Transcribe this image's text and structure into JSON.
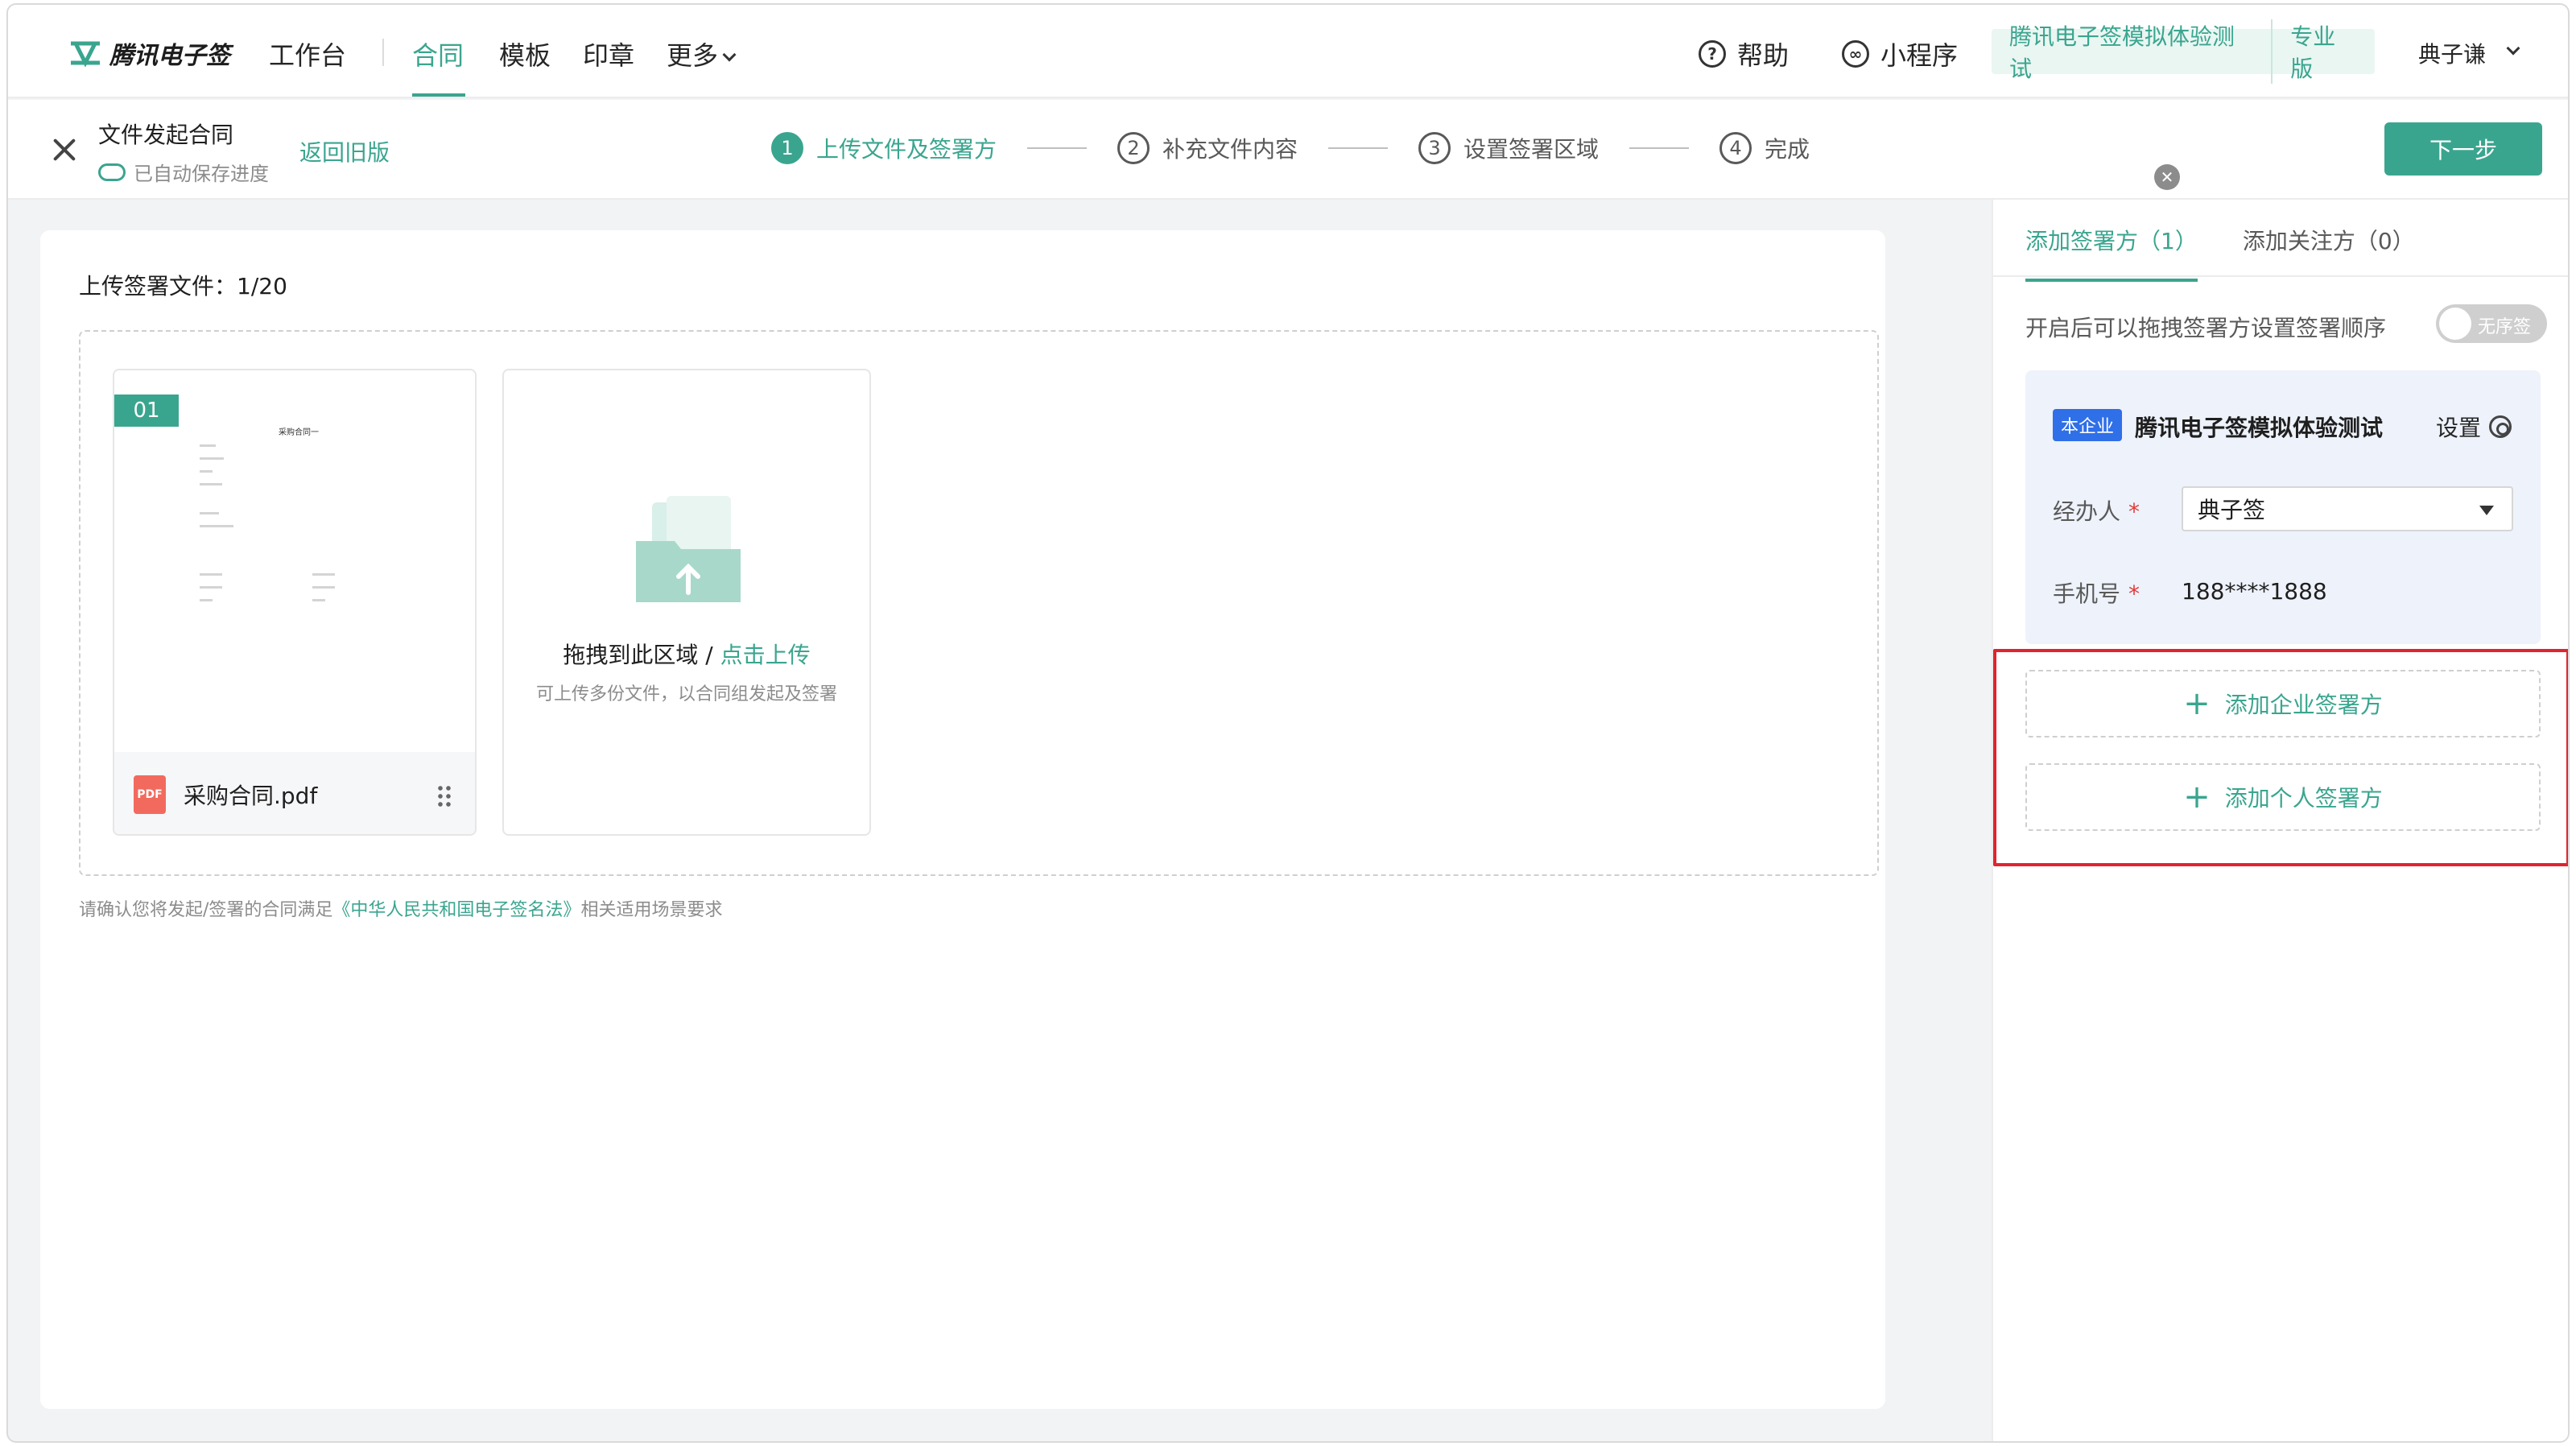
{
  "brand": {
    "name": "腾讯电子签",
    "accent": "#3aa58f"
  },
  "nav": {
    "items": [
      "工作台",
      "合同",
      "模板",
      "印章",
      "更多"
    ],
    "active": "合同",
    "help": "帮助",
    "mini_program": "小程序",
    "org_name": "腾讯电子签模拟体验测试",
    "org_edition": "专业版",
    "user": "典子谦"
  },
  "header": {
    "title": "文件发起合同",
    "autosave": "已自动保存进度",
    "back_old": "返回旧版",
    "steps": [
      {
        "num": "1",
        "label": "上传文件及签署方"
      },
      {
        "num": "2",
        "label": "补充文件内容"
      },
      {
        "num": "3",
        "label": "设置签署区域"
      },
      {
        "num": "4",
        "label": "完成"
      }
    ],
    "next": "下一步"
  },
  "main": {
    "upload_title": "上传签署文件：1/20",
    "file": {
      "index": "01",
      "name": "采购合同.pdf",
      "thumb_title": "采购合同一"
    },
    "upload_main": "拖拽到此区域 / ",
    "upload_link": "点击上传",
    "upload_sub": "可上传多份文件，以合同组发起及签署",
    "legal_prefix": "请确认您将发起/签署的合同满足",
    "legal_link": "《中华人民共和国电子签名法》",
    "legal_suffix": "相关适用场景要求"
  },
  "panel": {
    "tab_signers": "添加签署方（1）",
    "tab_watchers": "添加关注方（0）",
    "order_text": "开启后可以拖拽签署方设置签署顺序",
    "toggle_label": "无序签",
    "signer": {
      "tag": "本企业",
      "name": "腾讯电子签模拟体验测试",
      "settings": "设置",
      "handler_label": "经办人",
      "handler_value": "典子签",
      "phone_label": "手机号",
      "phone_value": "188****1888"
    },
    "add_enterprise": "添加企业签署方",
    "add_personal": "添加个人签署方"
  }
}
